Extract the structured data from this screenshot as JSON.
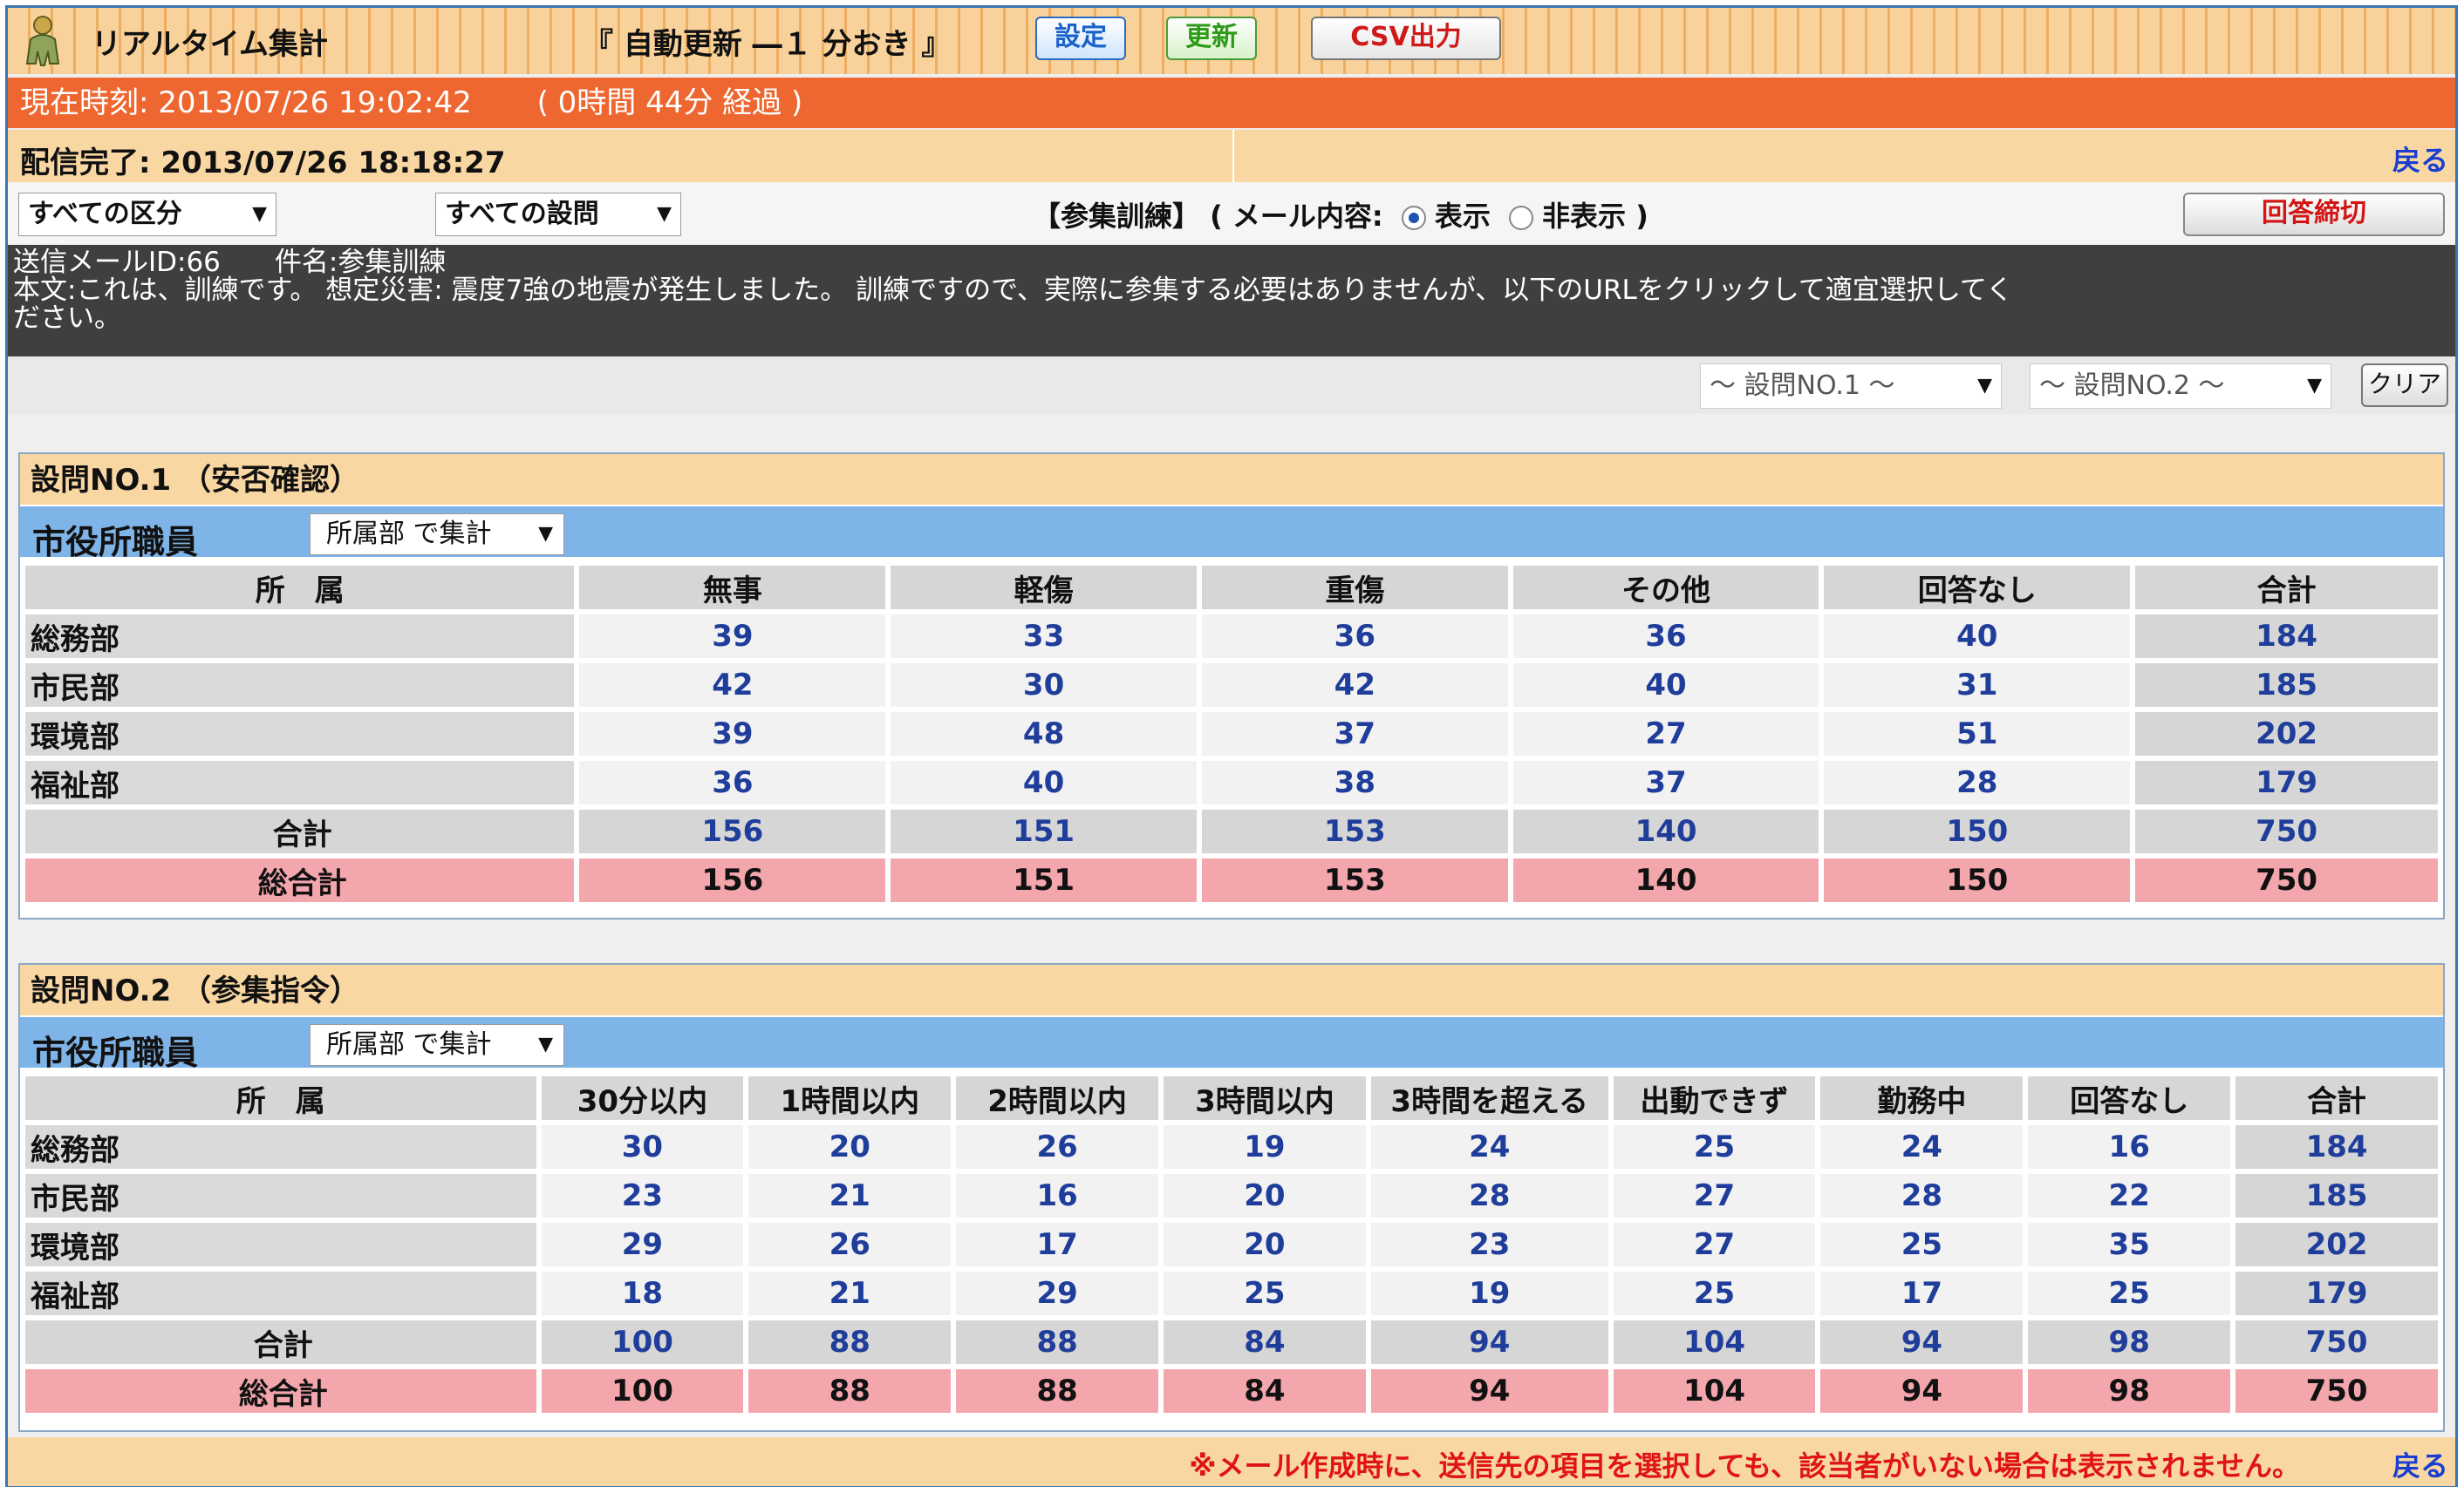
{
  "toolbar": {
    "app_title": "リアルタイム集計",
    "auto_update": "『 自動更新 ―１ 分おき 』",
    "settings_label": "設定",
    "refresh_label": "更新",
    "csv_label": "CSV出力"
  },
  "status": {
    "current_time": "現在時刻: 2013/07/26 19:02:42",
    "elapsed": "( 0時間 44分 経過 )",
    "delivery": "配信完了: 2013/07/26 18:18:27",
    "back_label": "戻る"
  },
  "filters": {
    "category": "すべての区分",
    "question": "すべての設問",
    "training_title": "【参集訓練】",
    "mail_prefix": "( メール内容:",
    "show_label": "表示",
    "hide_label": "非表示",
    "mail_suffix": ")",
    "close_label": "回答締切"
  },
  "mail": {
    "line1": "送信メールID:66　　件名:参集訓練",
    "line2": "本文:これは、訓練です。 想定災害: 震度7強の地震が発生しました。 訓練ですので、実際に参集する必要はありませんが、以下のURLをクリックして適宜選択してく",
    "line3": "ださい。"
  },
  "qfilter": {
    "q1": "～ 設問NO.1 ～",
    "q2": "～ 設問NO.2 ～",
    "clear_label": "クリア"
  },
  "q1": {
    "title": "設問NO.1 （安否確認）",
    "group": "市役所職員",
    "group_select": "所属部 で集計",
    "headers": [
      "所　属",
      "無事",
      "軽傷",
      "重傷",
      "その他",
      "回答なし",
      "合計"
    ],
    "rows": [
      [
        "総務部",
        "39",
        "33",
        "36",
        "36",
        "40",
        "184"
      ],
      [
        "市民部",
        "42",
        "30",
        "42",
        "40",
        "31",
        "185"
      ],
      [
        "環境部",
        "39",
        "48",
        "37",
        "27",
        "51",
        "202"
      ],
      [
        "福祉部",
        "36",
        "40",
        "38",
        "37",
        "28",
        "179"
      ]
    ],
    "sum": [
      "合計",
      "156",
      "151",
      "153",
      "140",
      "150",
      "750"
    ],
    "grand": [
      "総合計",
      "156",
      "151",
      "153",
      "140",
      "150",
      "750"
    ]
  },
  "q2": {
    "title": "設問NO.2 （参集指令）",
    "group": "市役所職員",
    "group_select": "所属部 で集計",
    "headers": [
      "所　属",
      "30分以内",
      "1時間以内",
      "2時間以内",
      "3時間以内",
      "3時間を超える",
      "出動できず",
      "勤務中",
      "回答なし",
      "合計"
    ],
    "rows": [
      [
        "総務部",
        "30",
        "20",
        "26",
        "19",
        "24",
        "25",
        "24",
        "16",
        "184"
      ],
      [
        "市民部",
        "23",
        "21",
        "16",
        "20",
        "28",
        "27",
        "28",
        "22",
        "185"
      ],
      [
        "環境部",
        "29",
        "26",
        "17",
        "20",
        "23",
        "27",
        "25",
        "35",
        "202"
      ],
      [
        "福祉部",
        "18",
        "21",
        "29",
        "25",
        "19",
        "25",
        "17",
        "25",
        "179"
      ]
    ],
    "sum": [
      "合計",
      "100",
      "88",
      "88",
      "84",
      "94",
      "104",
      "94",
      "98",
      "750"
    ],
    "grand": [
      "総合計",
      "100",
      "88",
      "88",
      "84",
      "94",
      "104",
      "94",
      "98",
      "750"
    ]
  },
  "footer": {
    "note": "※メール作成時に、送信先の項目を選択しても、該当者がいない場合は表示されません。",
    "back_label": "戻る"
  }
}
